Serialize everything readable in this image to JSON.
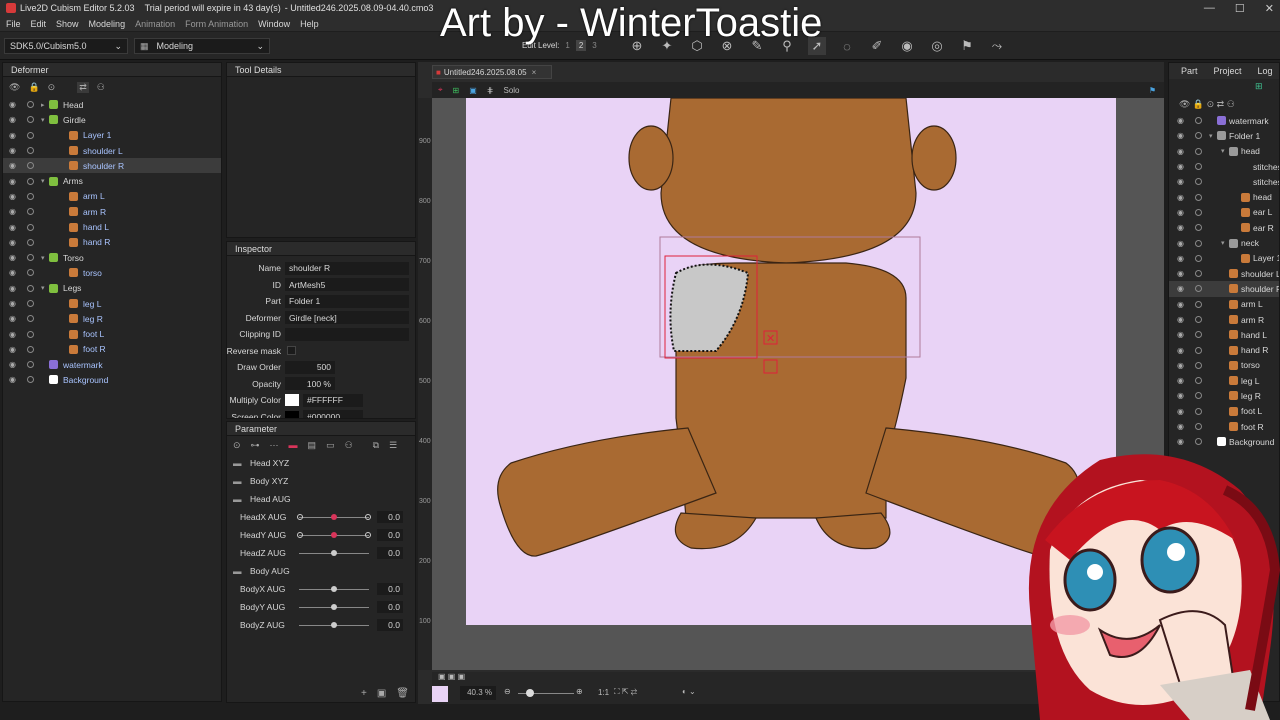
{
  "window": {
    "title": "Live2D Cubism Editor 5.2.03",
    "trial_notice": "Trial period will expire in 43 day(s)",
    "file": "- Untitled246.2025.08.09-04.40.cmo3"
  },
  "menu": [
    "File",
    "Edit",
    "Show",
    "Modeling",
    "Animation",
    "Form Animation",
    "Window",
    "Help"
  ],
  "overlay_caption": "Art by - WinterToastie",
  "toolbar": {
    "sdk_select": "SDK5.0/Cubism5.0",
    "mode_select": "Modeling",
    "edit_level_label": "Edit Level:",
    "edit_levels": [
      "1",
      "2",
      "3"
    ],
    "active_level": "2"
  },
  "deformer_panel": {
    "title": "Deformer",
    "items": [
      {
        "label": "Head",
        "depth": 0,
        "kind": "group"
      },
      {
        "label": "Girdle",
        "depth": 0,
        "kind": "group-open"
      },
      {
        "label": "Layer 1",
        "depth": 1,
        "kind": "mesh"
      },
      {
        "label": "shoulder L",
        "depth": 1,
        "kind": "mesh"
      },
      {
        "label": "shoulder R",
        "depth": 1,
        "kind": "mesh",
        "selected": true
      },
      {
        "label": "Arms",
        "depth": 0,
        "kind": "group-open"
      },
      {
        "label": "arm L",
        "depth": 1,
        "kind": "mesh"
      },
      {
        "label": "arm R",
        "depth": 1,
        "kind": "mesh"
      },
      {
        "label": "hand L",
        "depth": 1,
        "kind": "mesh"
      },
      {
        "label": "hand R",
        "depth": 1,
        "kind": "mesh"
      },
      {
        "label": "Torso",
        "depth": 0,
        "kind": "group-open"
      },
      {
        "label": "torso",
        "depth": 1,
        "kind": "mesh"
      },
      {
        "label": "Legs",
        "depth": 0,
        "kind": "group-open"
      },
      {
        "label": "leg L",
        "depth": 1,
        "kind": "mesh"
      },
      {
        "label": "leg R",
        "depth": 1,
        "kind": "mesh"
      },
      {
        "label": "foot L",
        "depth": 1,
        "kind": "mesh"
      },
      {
        "label": "foot R",
        "depth": 1,
        "kind": "mesh"
      },
      {
        "label": "watermark",
        "depth": 0,
        "kind": "text"
      },
      {
        "label": "Background",
        "depth": 0,
        "kind": "bg"
      }
    ]
  },
  "tool_details": {
    "title": "Tool Details"
  },
  "inspector": {
    "title": "Inspector",
    "rows": [
      {
        "key": "Name",
        "value": "shoulder R"
      },
      {
        "key": "ID",
        "value": "ArtMesh5"
      },
      {
        "key": "Part",
        "value": "Folder 1"
      },
      {
        "key": "Deformer",
        "value": "Girdle  [neck]"
      },
      {
        "key": "Clipping ID",
        "value": ""
      },
      {
        "key": "Reverse mask",
        "value": ""
      },
      {
        "key": "Draw Order",
        "value": "500"
      },
      {
        "key": "Opacity",
        "value": "100 %"
      },
      {
        "key": "Multiply Color",
        "value": "#FFFFFF"
      },
      {
        "key": "Screen Color",
        "value": "#000000"
      }
    ]
  },
  "parameter": {
    "title": "Parameter",
    "rows": [
      {
        "type": "folder",
        "name": "Head XYZ"
      },
      {
        "type": "folder",
        "name": "Body XYZ"
      },
      {
        "type": "folder",
        "name": "Head AUG"
      },
      {
        "type": "param",
        "name": "HeadX AUG",
        "value": "0.0",
        "pos": 0.5,
        "keyed": true
      },
      {
        "type": "param",
        "name": "HeadY AUG",
        "value": "0.0",
        "pos": 0.5,
        "keyed": true
      },
      {
        "type": "param",
        "name": "HeadZ AUG",
        "value": "0.0",
        "pos": 0.5,
        "keyed": false
      },
      {
        "type": "folder",
        "name": "Body AUG"
      },
      {
        "type": "param",
        "name": "BodyX AUG",
        "value": "0.0",
        "pos": 0.5,
        "keyed": false
      },
      {
        "type": "param",
        "name": "BodyY AUG",
        "value": "0.0",
        "pos": 0.5,
        "keyed": false
      },
      {
        "type": "param",
        "name": "BodyZ AUG",
        "value": "0.0",
        "pos": 0.5,
        "keyed": false
      }
    ]
  },
  "viewport": {
    "tab_title": "Untitled246.2025.08.05",
    "solo_label": "Solo",
    "ruler_labels": [
      "900",
      "800",
      "700",
      "600",
      "500",
      "400",
      "300",
      "200",
      "100"
    ],
    "zoom": "40.3 %",
    "ratio": "1:1",
    "canvas_color": "#e9d3f6"
  },
  "right_panel": {
    "tabs": [
      "Part",
      "Project",
      "Log"
    ],
    "items": [
      {
        "label": "watermark",
        "depth": 0,
        "kind": "text"
      },
      {
        "label": "Folder 1",
        "depth": 0,
        "kind": "folder"
      },
      {
        "label": "head",
        "depth": 1,
        "kind": "folder"
      },
      {
        "label": "stitches",
        "depth": 2,
        "kind": "none"
      },
      {
        "label": "stitches",
        "depth": 2,
        "kind": "none"
      },
      {
        "label": "head",
        "depth": 2,
        "kind": "mesh"
      },
      {
        "label": "ear L",
        "depth": 2,
        "kind": "mesh"
      },
      {
        "label": "ear R",
        "depth": 2,
        "kind": "mesh"
      },
      {
        "label": "neck",
        "depth": 1,
        "kind": "folder"
      },
      {
        "label": "Layer 1",
        "depth": 2,
        "kind": "mesh"
      },
      {
        "label": "shoulder L",
        "depth": 1,
        "kind": "mesh"
      },
      {
        "label": "shoulder R",
        "depth": 1,
        "kind": "mesh",
        "selected": true
      },
      {
        "label": "arm L",
        "depth": 1,
        "kind": "mesh"
      },
      {
        "label": "arm R",
        "depth": 1,
        "kind": "mesh"
      },
      {
        "label": "hand L",
        "depth": 1,
        "kind": "mesh"
      },
      {
        "label": "hand R",
        "depth": 1,
        "kind": "mesh"
      },
      {
        "label": "torso",
        "depth": 1,
        "kind": "mesh"
      },
      {
        "label": "leg L",
        "depth": 1,
        "kind": "mesh"
      },
      {
        "label": "leg R",
        "depth": 1,
        "kind": "mesh"
      },
      {
        "label": "foot L",
        "depth": 1,
        "kind": "mesh"
      },
      {
        "label": "foot R",
        "depth": 1,
        "kind": "mesh"
      },
      {
        "label": "Background",
        "depth": 0,
        "kind": "bg"
      }
    ]
  },
  "colors": {
    "accent": "#d9345a",
    "mesh_icon": "#c97a3a",
    "text_icon": "#8a6fd6",
    "skin": "#a96a32"
  }
}
